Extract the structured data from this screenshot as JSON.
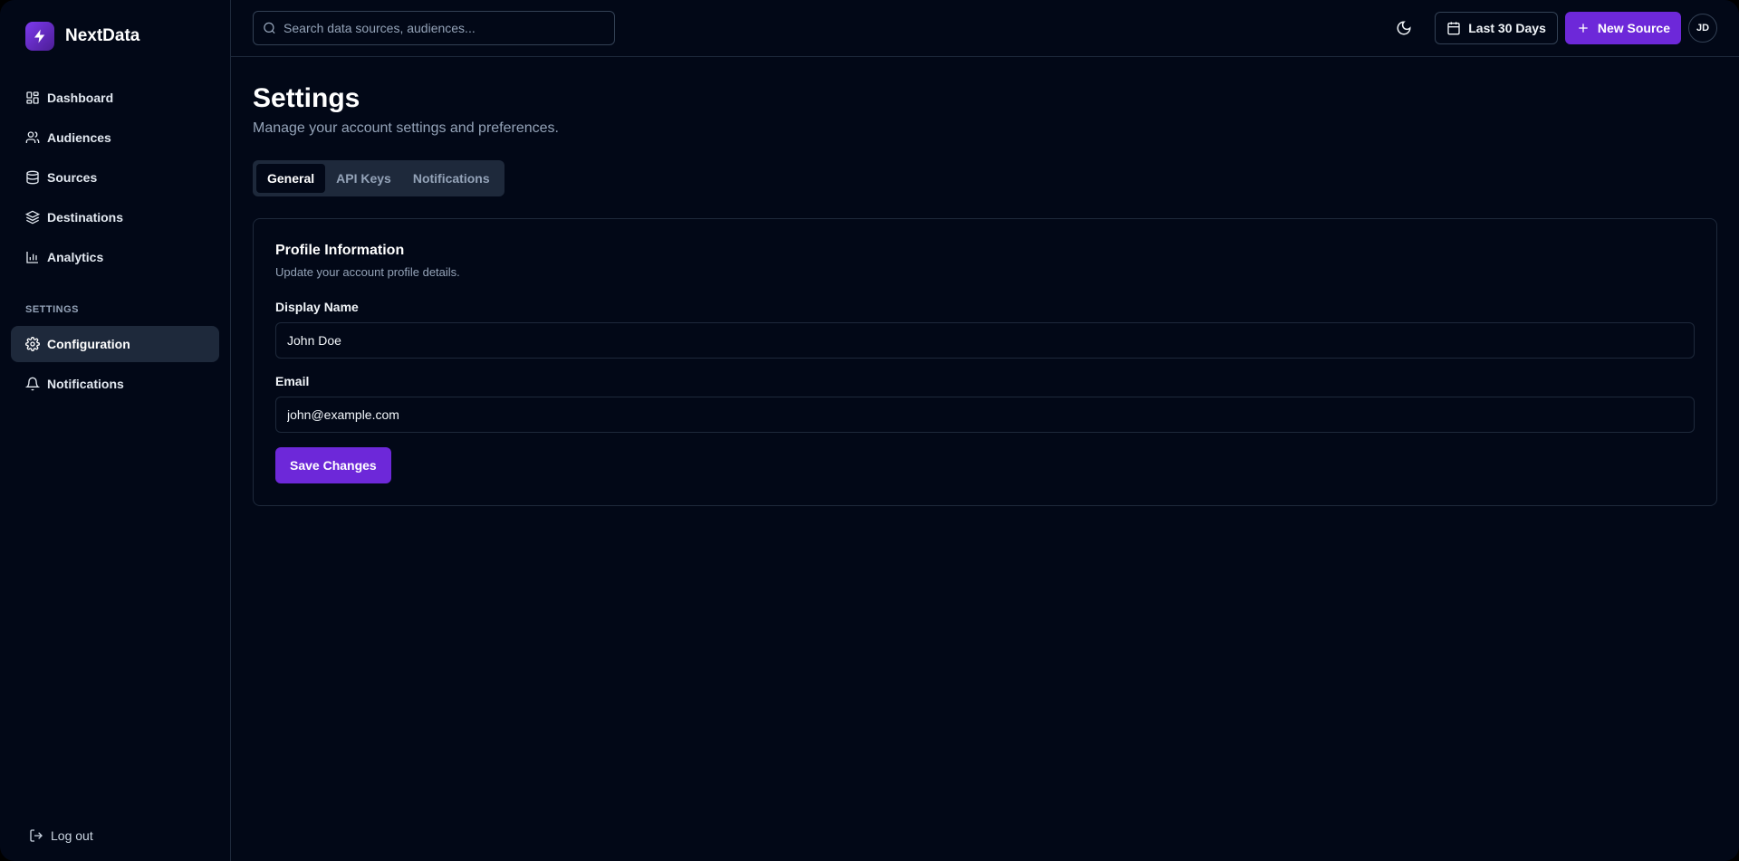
{
  "app": {
    "name": "NextData"
  },
  "sidebar": {
    "nav": [
      {
        "label": "Dashboard",
        "icon": "dashboard-icon"
      },
      {
        "label": "Audiences",
        "icon": "users-icon"
      },
      {
        "label": "Sources",
        "icon": "database-icon"
      },
      {
        "label": "Destinations",
        "icon": "layers-icon"
      },
      {
        "label": "Analytics",
        "icon": "bar-chart-icon"
      }
    ],
    "section_label": "SETTINGS",
    "settings_nav": [
      {
        "label": "Configuration",
        "icon": "gear-icon",
        "active": true
      },
      {
        "label": "Notifications",
        "icon": "bell-icon"
      }
    ],
    "logout_label": "Log out"
  },
  "topbar": {
    "search_placeholder": "Search data sources, audiences...",
    "date_range_label": "Last 30 Days",
    "new_source_label": "New Source",
    "avatar_initials": "JD"
  },
  "page": {
    "title": "Settings",
    "subtitle": "Manage your account settings and preferences.",
    "tabs": [
      {
        "label": "General",
        "active": true
      },
      {
        "label": "API Keys"
      },
      {
        "label": "Notifications"
      }
    ]
  },
  "profile_card": {
    "title": "Profile Information",
    "subtitle": "Update your account profile details.",
    "display_name_label": "Display Name",
    "display_name_value": "John Doe",
    "email_label": "Email",
    "email_value": "john@example.com",
    "save_label": "Save Changes"
  },
  "colors": {
    "background": "#020817",
    "border": "#1e293b",
    "accent": "#6d28d9",
    "muted_text": "#94a3b8"
  }
}
